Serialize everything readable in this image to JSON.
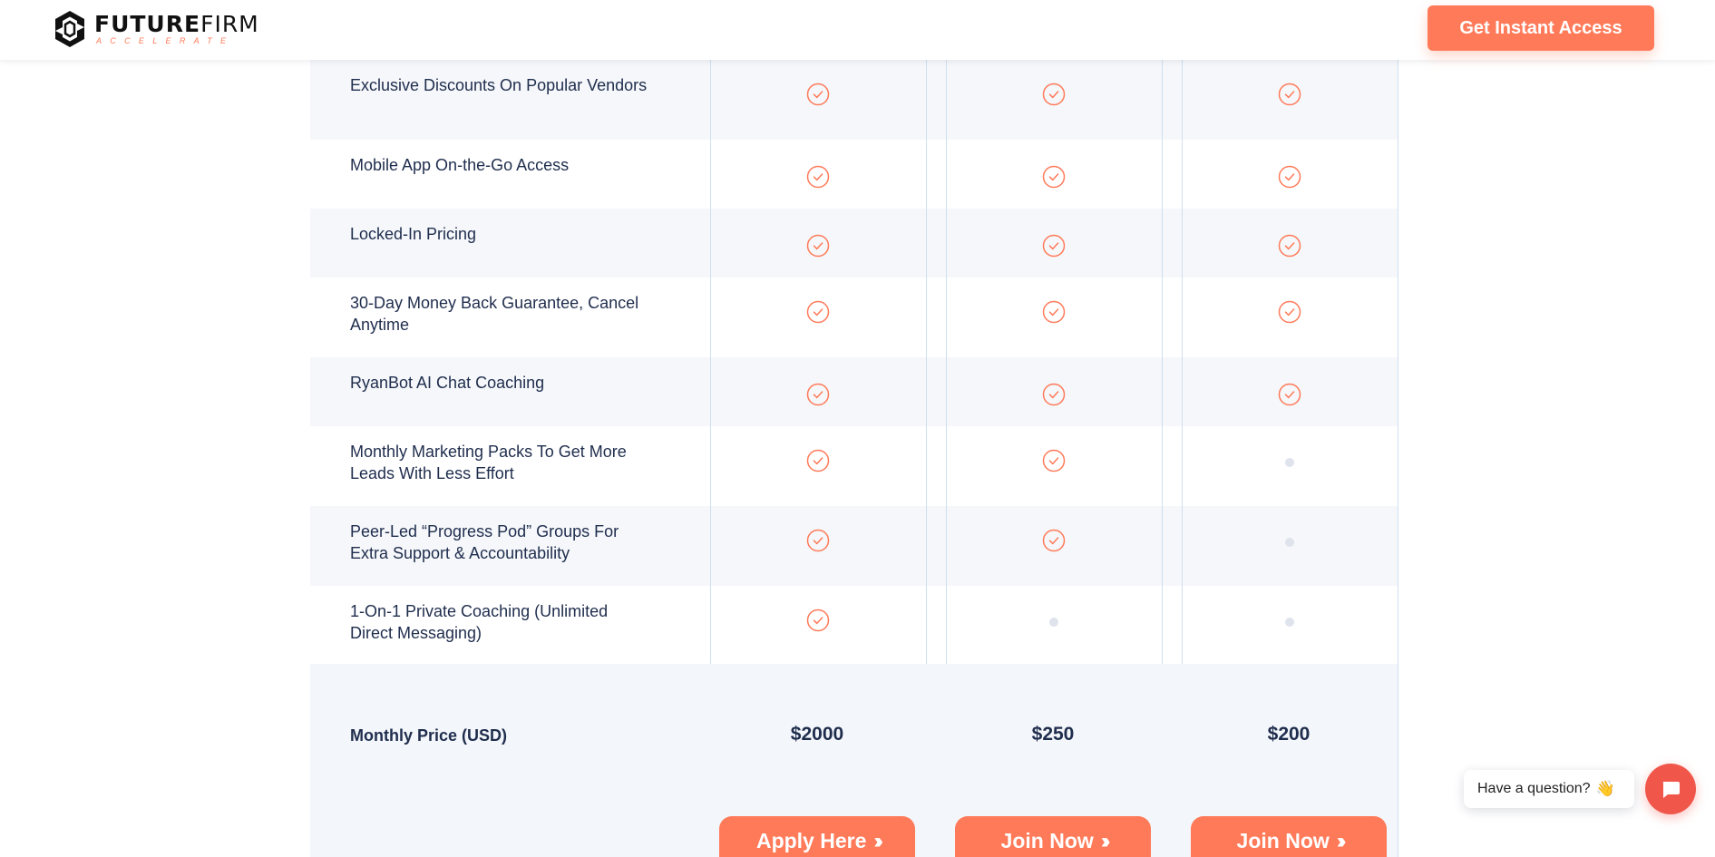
{
  "header": {
    "logo_main_bold": "FUTURE",
    "logo_main_thin": "FIRM",
    "logo_sub": "ACCELERATE",
    "cta_label": "Get Instant Access"
  },
  "features": [
    {
      "label": "Exclusive Discounts On Popular Vendors",
      "tiers": [
        "check",
        "check",
        "check"
      ]
    },
    {
      "label": "Mobile App On-the-Go Access",
      "tiers": [
        "check",
        "check",
        "check"
      ]
    },
    {
      "label": "Locked-In Pricing",
      "tiers": [
        "check",
        "check",
        "check"
      ]
    },
    {
      "label": "30-Day Money Back Guarantee, Cancel Anytime",
      "tiers": [
        "check",
        "check",
        "check"
      ]
    },
    {
      "label": "RyanBot AI Chat Coaching",
      "tiers": [
        "check",
        "check",
        "check"
      ]
    },
    {
      "label": "Monthly Marketing Packs To Get More Leads With Less Effort",
      "tiers": [
        "check",
        "check",
        "none"
      ]
    },
    {
      "label": "Peer-Led “Progress Pod” Groups For Extra Support & Accountability",
      "tiers": [
        "check",
        "check",
        "none"
      ]
    },
    {
      "label": "1-On-1 Private Coaching (Unlimited Direct Messaging)",
      "tiers": [
        "check",
        "none",
        "none"
      ]
    }
  ],
  "pricing": {
    "label": "Monthly Price (USD)",
    "prices": [
      "$2000",
      "$250",
      "$200"
    ]
  },
  "buttons": [
    "Apply Here",
    "Join Now",
    "Join Now"
  ],
  "chat": {
    "prompt": "Have a question?",
    "emoji": "👋"
  },
  "colors": {
    "accent": "#ff7a59",
    "check": "#ff7a59",
    "missing_dot": "#dfe3ec",
    "shaded_row": "#f5f7fa",
    "divider": "#cfe0f0"
  }
}
